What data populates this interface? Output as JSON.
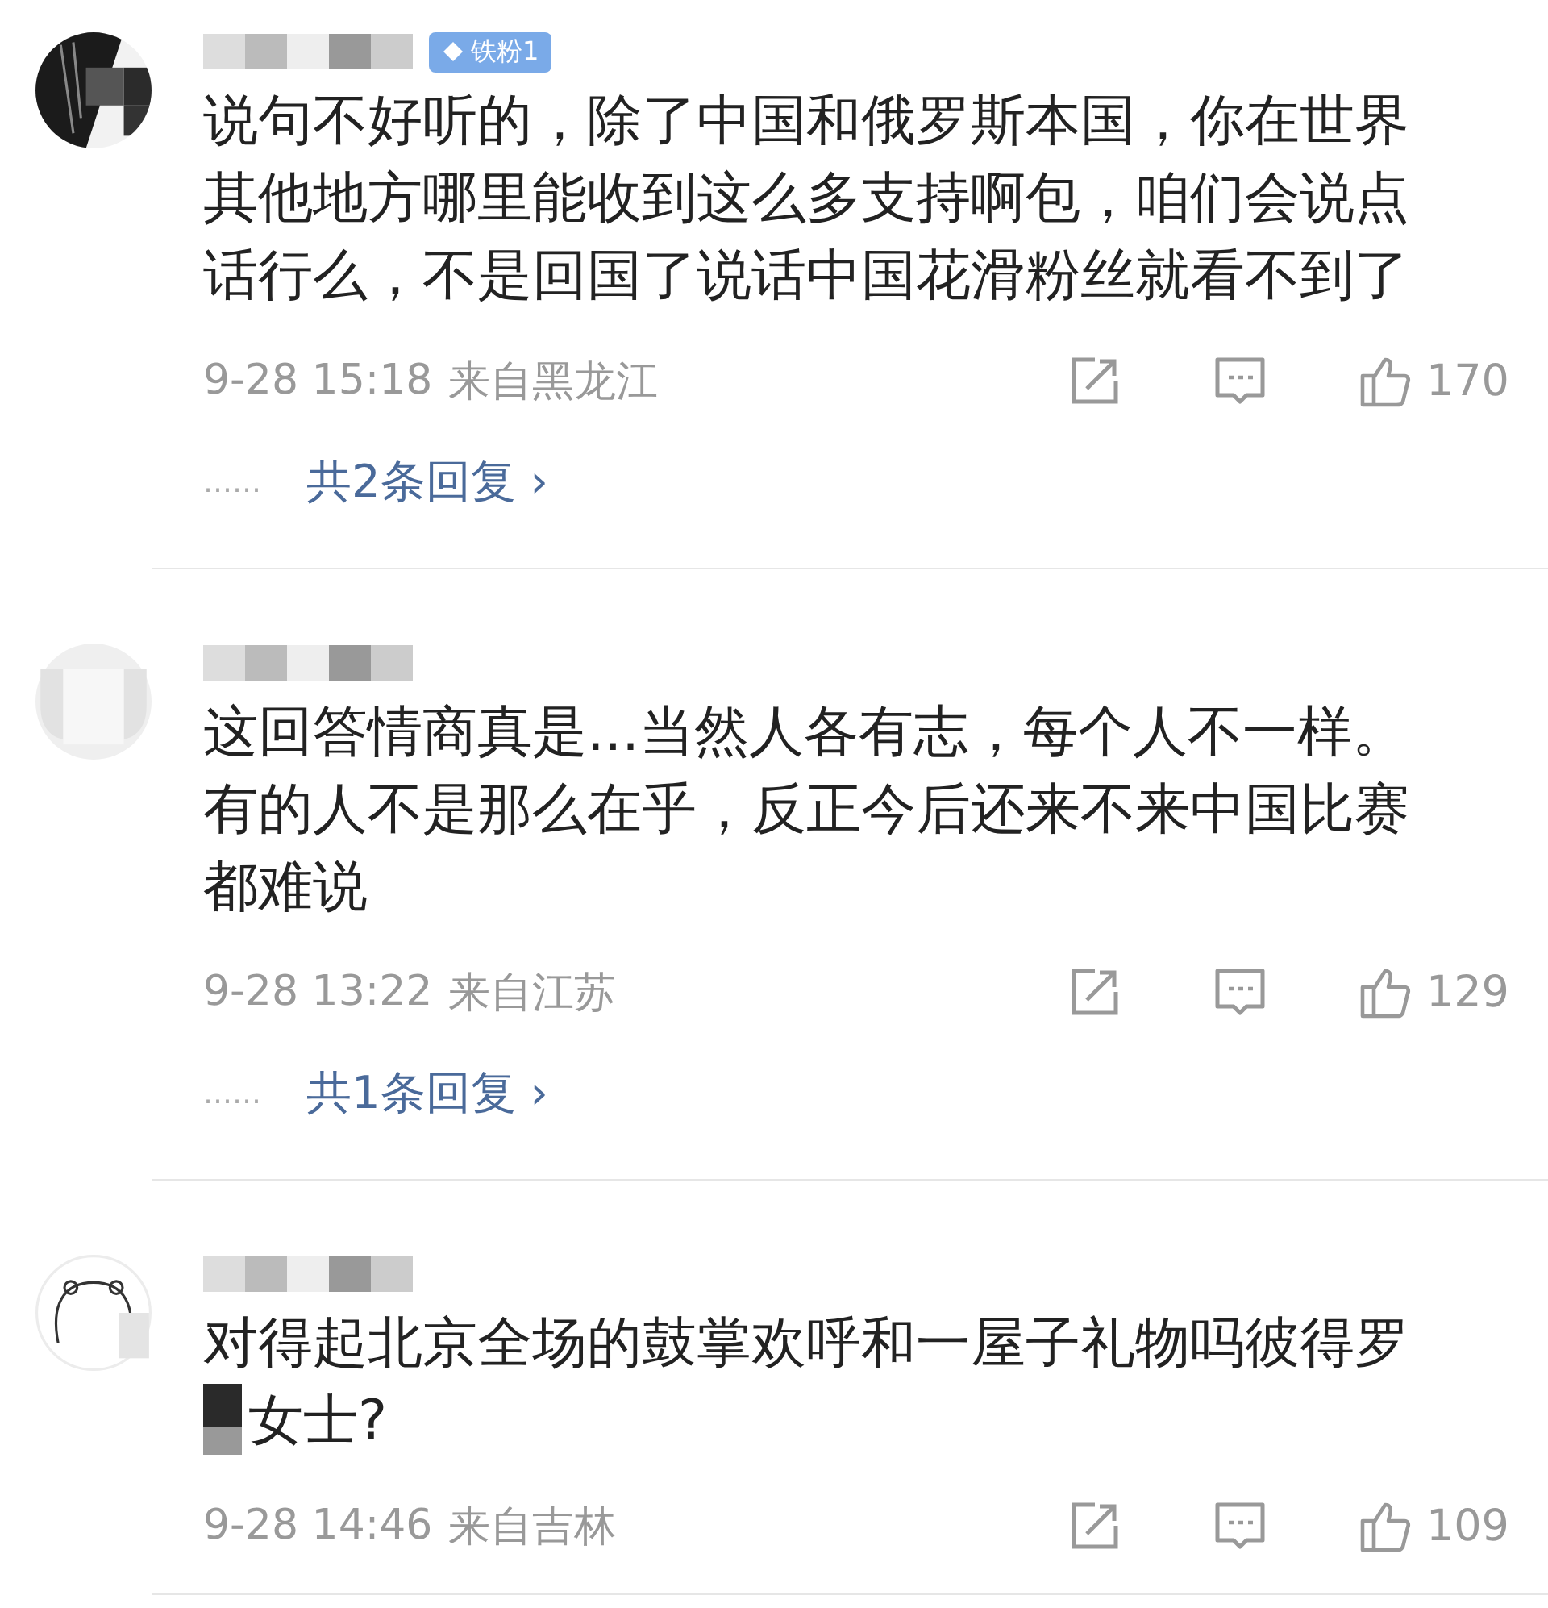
{
  "comments": [
    {
      "avatar": {
        "kind": "dark"
      },
      "badge": "铁粉1",
      "lines": [
        "说句不好听的，除了中国和俄罗斯本国，你在世界",
        "其他地方哪里能收到这么多支持啊包，咱们会说点",
        "话行么，不是回国了说话中国花滑粉丝就看不到了"
      ],
      "date": "9-28 15:18",
      "location": "来自黑龙江",
      "likes": "170",
      "reply_dots": "……",
      "replies": "共2条回复",
      "reply_arrow": "›"
    },
    {
      "avatar": {
        "kind": "blank"
      },
      "lines": [
        "这回答情商真是...当然人各有志，每个人不一样。",
        "有的人不是那么在乎，反正今后还来不来中国比赛",
        "都难说"
      ],
      "date": "9-28 13:22",
      "location": "来自江苏",
      "likes": "129",
      "reply_dots": "……",
      "replies": "共1条回复",
      "reply_arrow": "›"
    },
    {
      "avatar": {
        "kind": "bear"
      },
      "lines": [
        "对得起北京全场的鼓掌欢呼和一屋子礼物吗彼得罗",
        "女士?"
      ],
      "redacted_last_line_start": true,
      "date": "9-28 14:46",
      "location": "来自吉林",
      "likes": "109"
    }
  ]
}
